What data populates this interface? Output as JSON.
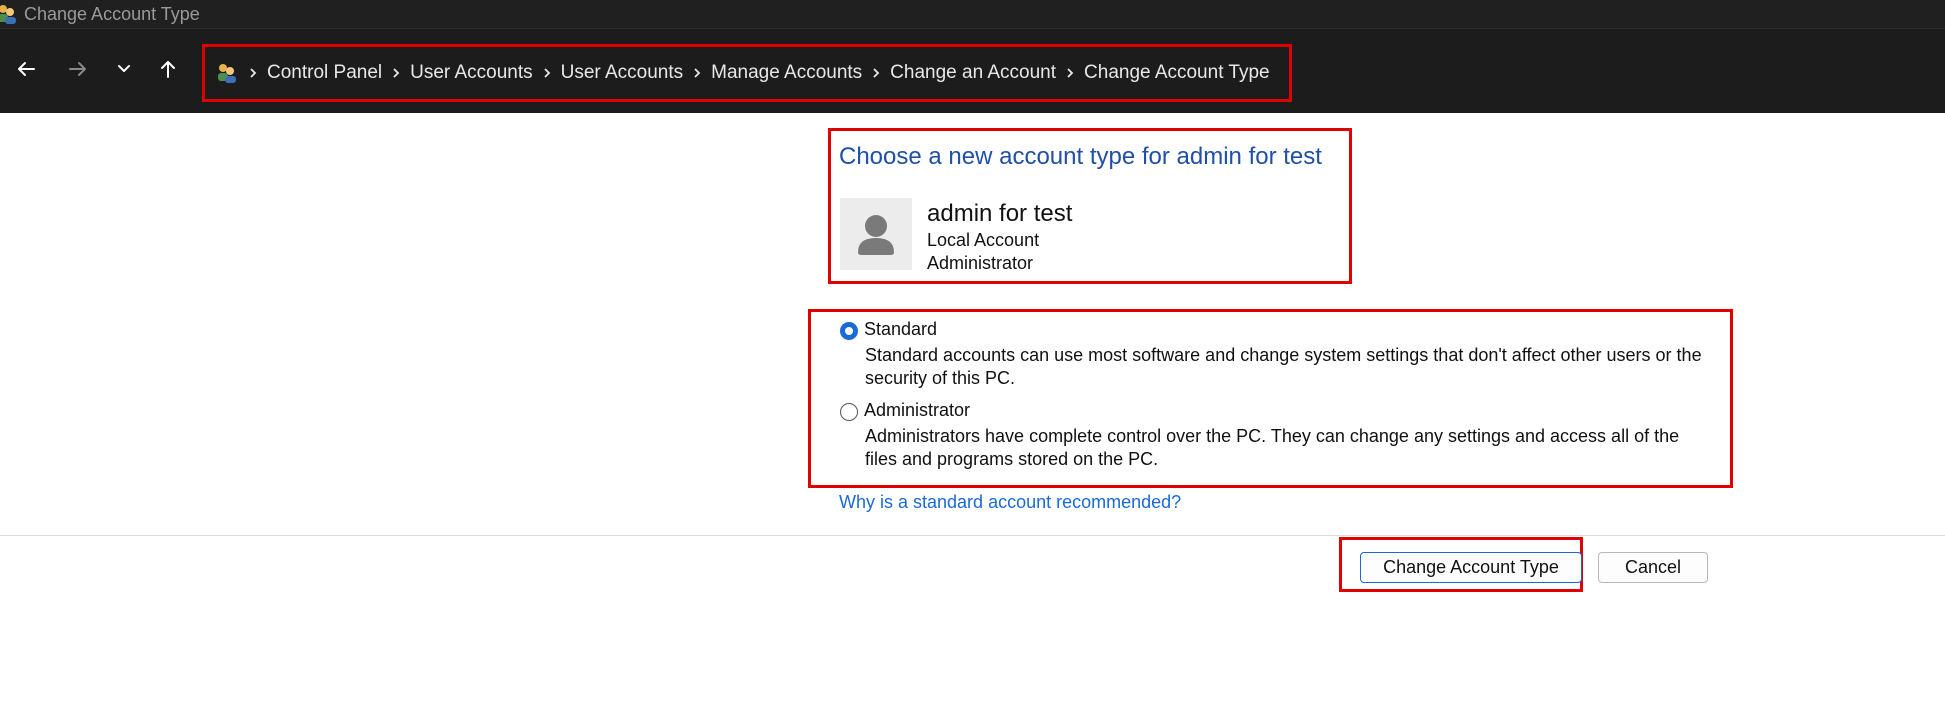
{
  "window": {
    "title": "Change Account Type",
    "icon": "users-icon"
  },
  "nav": {
    "back_icon": "arrow-left-icon",
    "forward_icon": "arrow-right-icon",
    "recent_icon": "chevron-down-icon",
    "up_icon": "arrow-up-icon"
  },
  "breadcrumb": {
    "root_icon": "users-icon",
    "items": [
      {
        "label": "Control Panel"
      },
      {
        "label": "User Accounts"
      },
      {
        "label": "User Accounts"
      },
      {
        "label": "Manage Accounts"
      },
      {
        "label": "Change an Account"
      },
      {
        "label": "Change Account Type"
      }
    ]
  },
  "main": {
    "heading": "Choose a new account type for admin for test",
    "account": {
      "name": "admin for test",
      "type": "Local Account",
      "role": "Administrator",
      "avatar_icon": "user-avatar-icon"
    },
    "options": [
      {
        "label": "Standard",
        "description": "Standard accounts can use most software and change system settings that don't affect other users or the security of this PC.",
        "selected": true
      },
      {
        "label": "Administrator",
        "description": "Administrators have complete control over the PC. They can change any settings and access all of the files and programs stored on the PC.",
        "selected": false
      }
    ],
    "help_link": "Why is a standard account recommended?"
  },
  "footer": {
    "primary_button": "Change Account Type",
    "cancel_button": "Cancel"
  },
  "colors": {
    "accent": "#1a6ad6",
    "heading": "#1f4fa8",
    "highlight": "#e00000",
    "titlebar_bg": "#202020",
    "navbar_bg": "#1c1c1c"
  }
}
